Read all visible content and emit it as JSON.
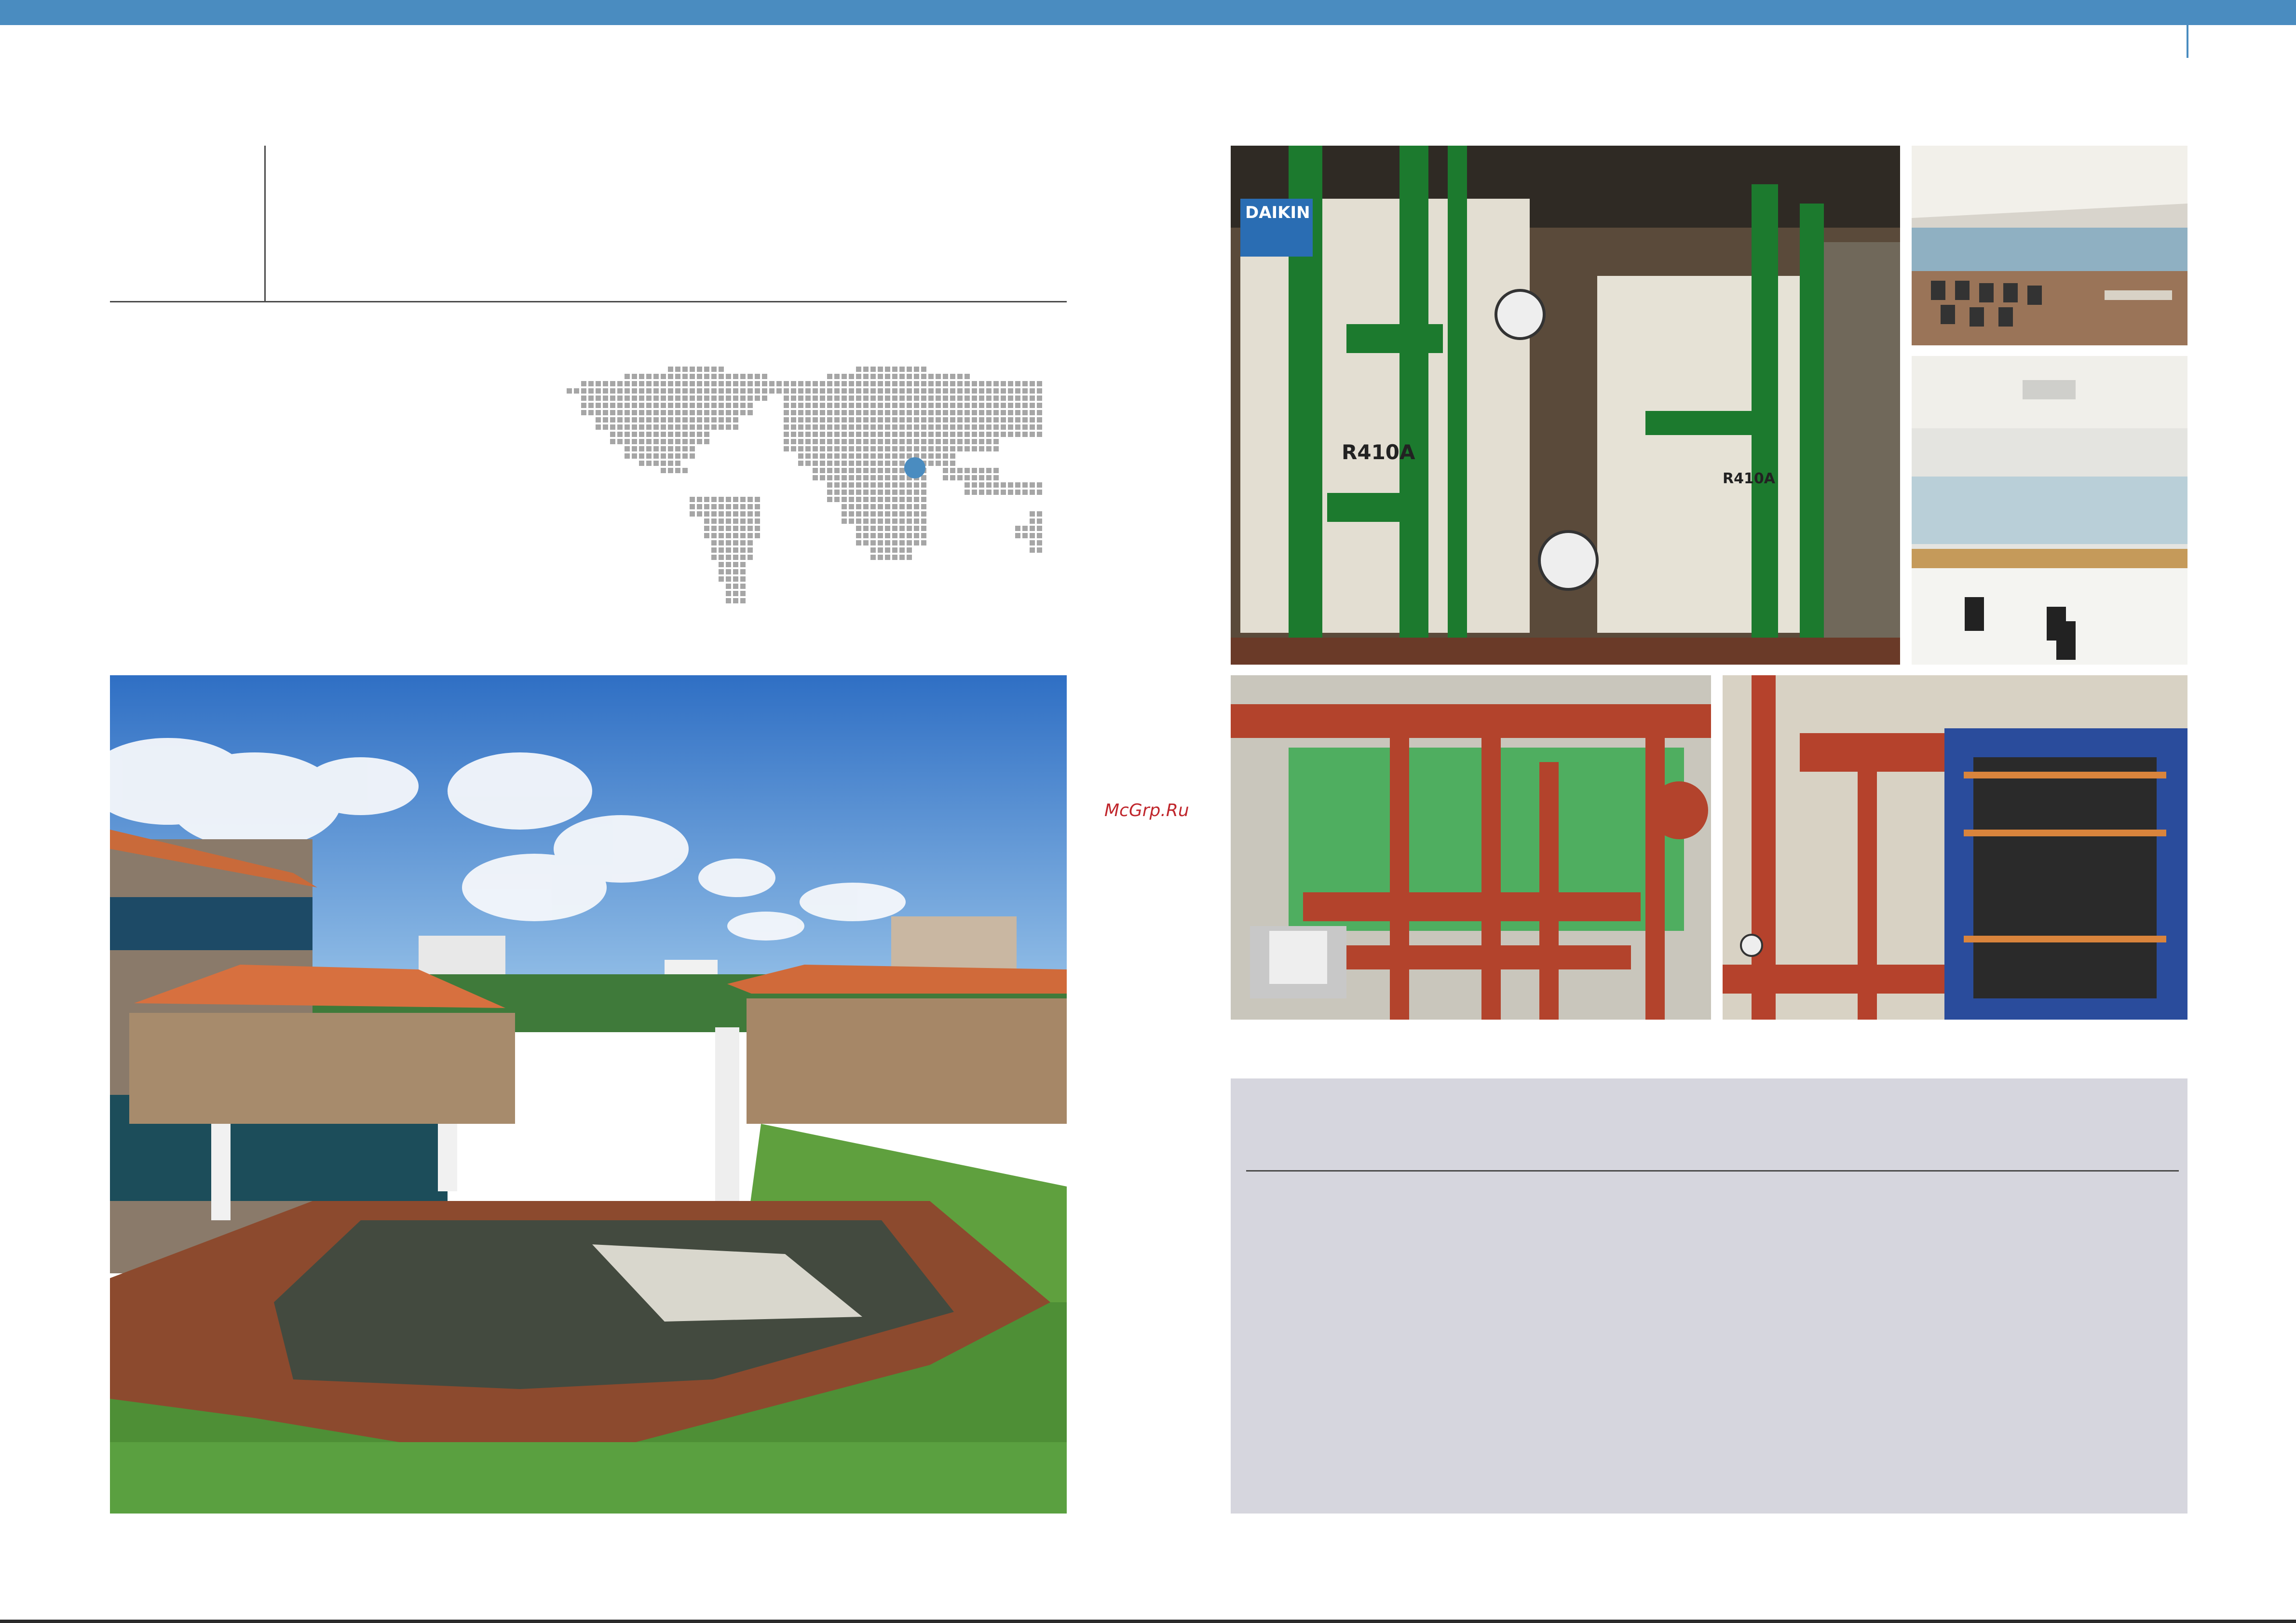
{
  "page": {
    "watermark": "McGrp.Ru",
    "colors": {
      "accent_bar": "#4a8cc0",
      "map_dot": "#a6a6a6",
      "map_highlight": "#4a8cc0",
      "info_panel": "#d6d6de",
      "rule": "#4a4a4a"
    }
  },
  "map": {
    "icon": "world-dot-map",
    "highlight_icon": "location-marker-icon",
    "highlighted_region": "India"
  },
  "photos": [
    {
      "key": "campus",
      "icon": "campus-building-photo"
    },
    {
      "key": "daikin",
      "icon": "daikin-vrv-units-photo",
      "labels": [
        "DAIKIN",
        "R410A",
        "R410A"
      ]
    },
    {
      "key": "hall",
      "icon": "seminar-hall-photo"
    },
    {
      "key": "office",
      "icon": "open-office-photo"
    },
    {
      "key": "pumps",
      "icon": "pump-room-photo"
    },
    {
      "key": "exchanger",
      "icon": "plate-heat-exchanger-photo"
    }
  ]
}
